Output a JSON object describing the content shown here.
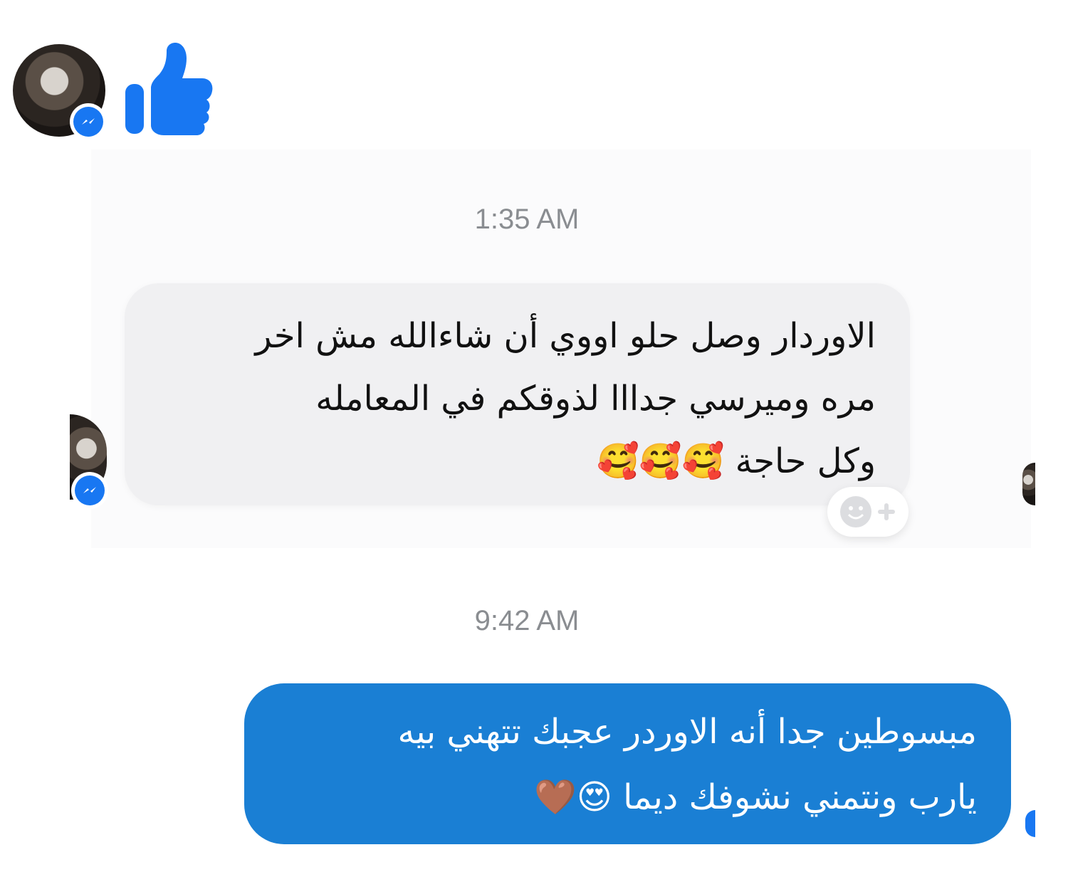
{
  "conversation": {
    "timestamps": [
      "1:35 AM",
      "9:42 AM"
    ],
    "incoming_message": {
      "line1": "الاوردار وصل حلو اووي أن شاءالله مش اخر",
      "line2": "مره وميرسي جدااا لذوقكم في المعامله",
      "line3": "وكل حاجة 🥰🥰🥰"
    },
    "outgoing_message": {
      "line1": "مبسوطين جدا أنه الاوردر عجبك تتهني بيه",
      "line2": "يارب ونتمني نشوفك ديما 😍🤎"
    }
  },
  "icons": {
    "like": "thumbs-up-icon",
    "messenger": "messenger-icon",
    "reaction": "add-reaction-icon"
  },
  "colors": {
    "messenger_blue": "#1877f2",
    "outgoing_bubble": "#1a7fd4",
    "incoming_bubble": "#f0f0f2",
    "timestamp": "#8a8d91"
  }
}
